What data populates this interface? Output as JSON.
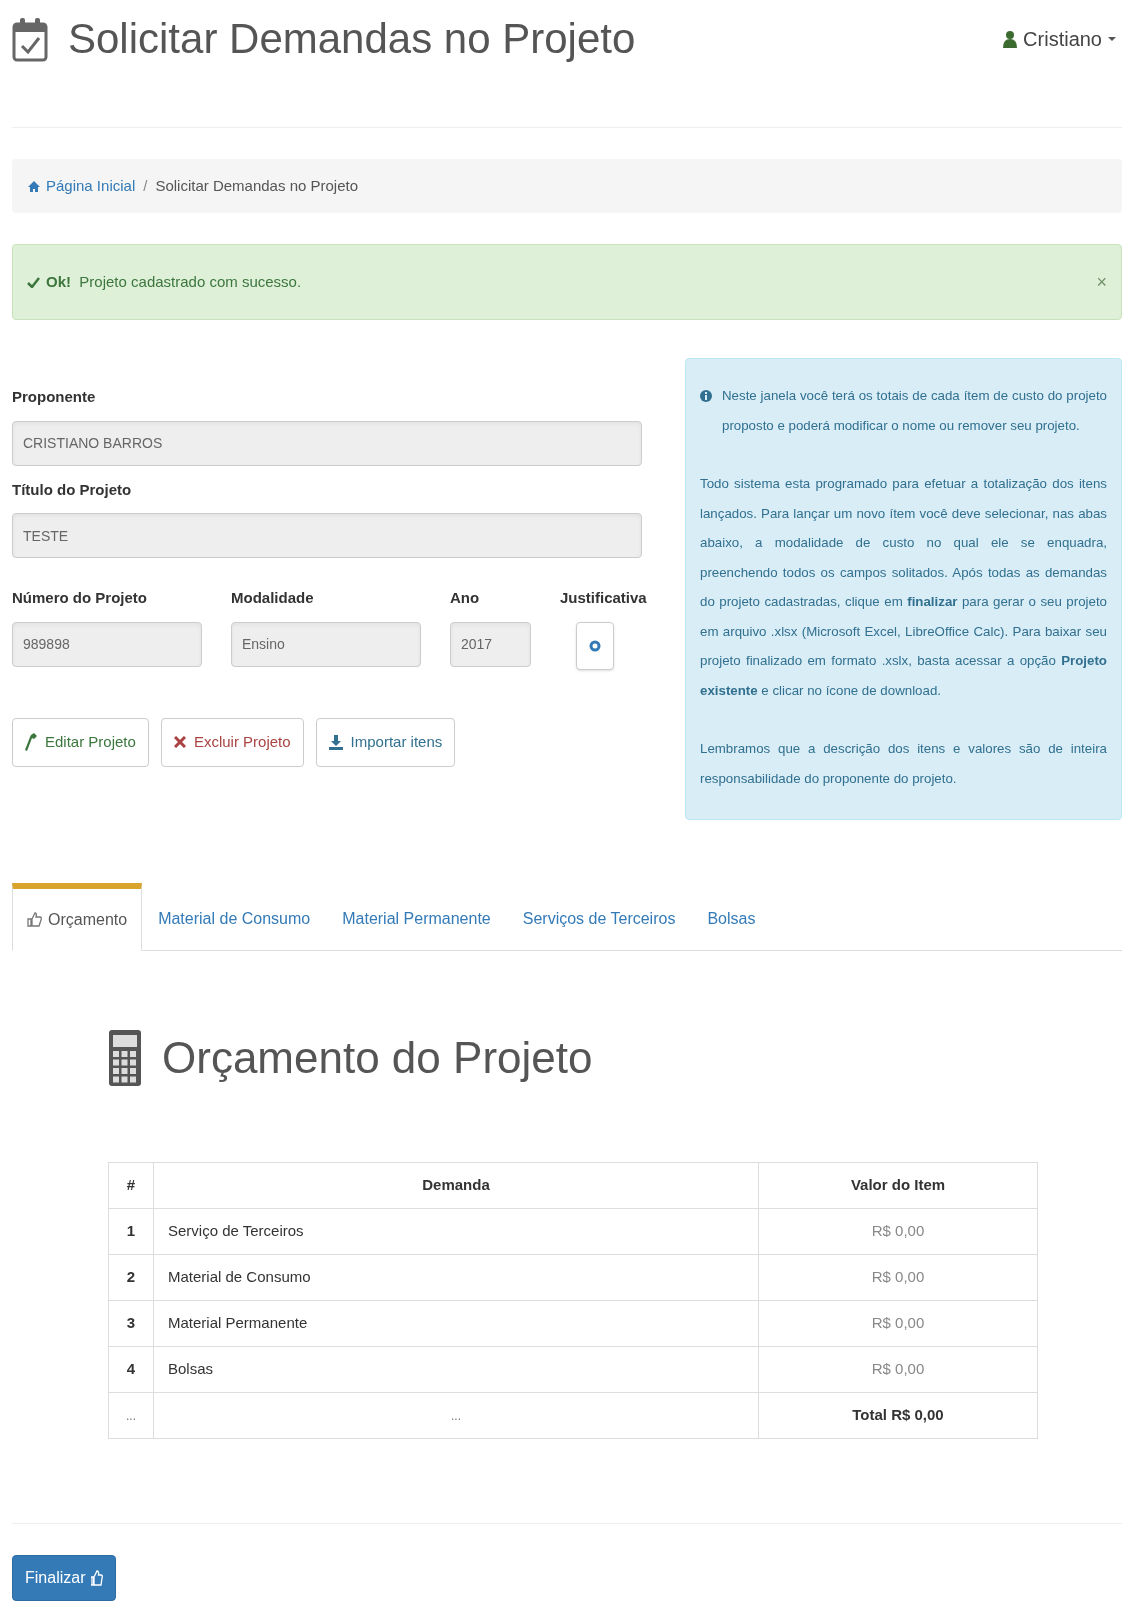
{
  "header": {
    "title": "Solicitar Demandas no Projeto",
    "user": "Cristiano"
  },
  "breadcrumb_separator": "/",
  "breadcrumb": [
    {
      "label": "Página Inicial",
      "kind": "link"
    },
    {
      "label": "Solicitar Demandas no Projeto",
      "kind": "current"
    }
  ],
  "alert": {
    "text": "**Ok!**  Projeto cadastrado com sucesso.",
    "close": "×"
  },
  "form": {
    "fields": [
      {
        "label": "Proponente",
        "value": "CRISTIANO BARROS",
        "kind": "wide"
      },
      {
        "label": "Título do Projeto",
        "value": "TESTE",
        "kind": "wide"
      },
      {
        "label": "Número do Projeto",
        "value": "989898",
        "kind": "medium"
      },
      {
        "label": "Modalidade",
        "value": "Ensino",
        "kind": "medium"
      },
      {
        "label": "Ano",
        "value": "2017",
        "kind": "small"
      },
      {
        "label": "Justificativa",
        "kind": "button"
      }
    ],
    "buttons": [
      {
        "label": "Editar Projeto",
        "kind": "edit"
      },
      {
        "label": "Excluir Projeto",
        "kind": "delete"
      },
      {
        "label": "Importar itens",
        "kind": "import"
      }
    ]
  },
  "info": {
    "paragraphs": [
      "Neste janela você terá os totais de cada ítem de custo do projeto proposto e poderá modificar o nome ou remover seu projeto.",
      "Todo sistema esta programado para efetuar a totalização dos itens lançados. Para lançar um novo ítem você deve selecionar, nas abas abaixo, a modalidade de custo no qual ele se enquadra, preenchendo todos os campos solitados. Após todas as demandas do projeto cadastradas, clique em **finalizar** para gerar o seu projeto em arquivo .xlsx (Microsoft Excel, LibreOffice Calc). Para baixar seu projeto finalizado em formato .xslx, basta acessar a opção **Projeto existente** e clicar no ícone de download.",
      "Lembramos que a descrição dos itens e valores são de inteira responsabilidade do proponente do projeto."
    ]
  },
  "tabs": [
    {
      "label": "Orçamento",
      "selected": true
    },
    {
      "label": "Material de Consumo",
      "selected": false
    },
    {
      "label": "Material Permanente",
      "selected": false
    },
    {
      "label": "Serviços de Terceiros",
      "selected": false
    },
    {
      "label": "Bolsas",
      "selected": false
    }
  ],
  "budget": {
    "title": "Orçamento do Projeto",
    "columns": [
      "#",
      "Demanda",
      "Valor do Item"
    ],
    "rows": [
      {
        "cells": [
          "1",
          "Serviço de Terceiros",
          "R$ 0,00"
        ],
        "kind": "item"
      },
      {
        "cells": [
          "2",
          "Material de Consumo",
          "R$ 0,00"
        ],
        "kind": "item"
      },
      {
        "cells": [
          "3",
          "Material Permanente",
          "R$ 0,00"
        ],
        "kind": "item"
      },
      {
        "cells": [
          "4",
          "Bolsas",
          "R$ 0,00"
        ],
        "kind": "item"
      },
      {
        "cells": [
          "...",
          "...",
          "Total R$ 0,00"
        ],
        "kind": "total"
      }
    ]
  },
  "finish_button": "Finalizar"
}
